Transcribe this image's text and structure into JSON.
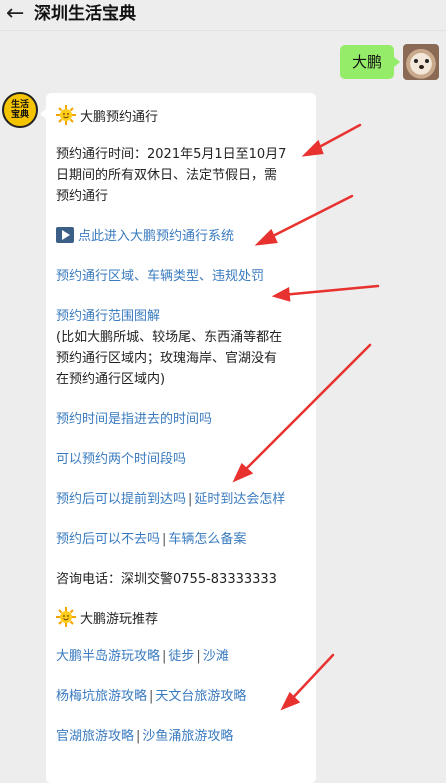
{
  "header": {
    "back_icon": "back-arrow-icon",
    "title": "深圳生活宝典"
  },
  "user_message": {
    "text": "大鹏"
  },
  "bot": {
    "avatar_text_1": "生活",
    "avatar_text_2": "宝典"
  },
  "reply": {
    "section1_title": "大鹏预约通行",
    "intro_1": "预约通行时间：2021年5月1日至10月7",
    "intro_2": "日期间的所有双休日、法定节假日，需",
    "intro_3": "预约通行",
    "system_link": "点此进入大鹏预约通行系统",
    "rules_link": "预约通行区域、车辆类型、违规处罚",
    "map_link": "预约通行范围图解",
    "note_1": "(比如大鹏所城、较场尾、东西涌等都在",
    "note_2": "预约通行区域内；玫瑰海岸、官湖没有",
    "note_3": "在预约通行区域内)",
    "q1": "预约时间是指进去的时间吗",
    "q2": "可以预约两个时间段吗",
    "q3a": "预约后可以提前到达吗",
    "q3b": "延时到达会怎样",
    "q4a": "预约后可以不去吗",
    "q4b": "车辆怎么备案",
    "contact": "咨询电话：深圳交警0755-83333333",
    "section2_title": "大鹏游玩推荐",
    "t1a": "大鹏半岛游玩攻略",
    "t1b": "徒步",
    "t1c": "沙滩",
    "t2a": "杨梅坑旅游攻略",
    "t2b": "天文台旅游攻略",
    "t3a": "官湖旅游攻略",
    "t3b": "沙鱼涌旅游攻略",
    "separator": "|"
  },
  "colors": {
    "link": "#3a7bbf",
    "bubble_green": "#95ec69",
    "annotation_red": "#e8322f"
  }
}
